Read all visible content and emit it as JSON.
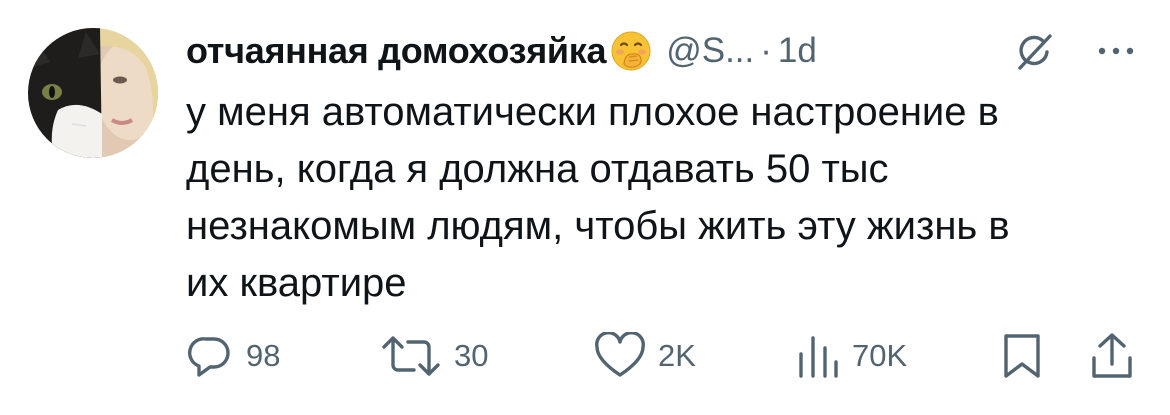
{
  "tweet": {
    "author_name": "отчаянная домохозяйка",
    "author_emoji_icon": "face-with-hand-over-mouth-emoji",
    "handle": "@S...",
    "separator": "·",
    "time": "1d",
    "text_lines": [
      "у меня автоматически плохое настроение в",
      "день, когда я должна отдавать 50 тыс",
      "незнакомым людям, чтобы жить эту жизнь в",
      "их квартире"
    ]
  },
  "actions": {
    "replies": "98",
    "reposts": "30",
    "likes": "2K",
    "views": "70K"
  },
  "icons": {
    "reply": "reply-icon",
    "repost": "repost-icon",
    "like": "heart-icon",
    "views": "views-chart-icon",
    "bookmark": "bookmark-icon",
    "share": "share-icon",
    "grok": "grok-icon",
    "more": "more-dots-icon"
  },
  "colors": {
    "text": "#0f1419",
    "secondary": "#536471",
    "emoji": "#f7c234"
  }
}
